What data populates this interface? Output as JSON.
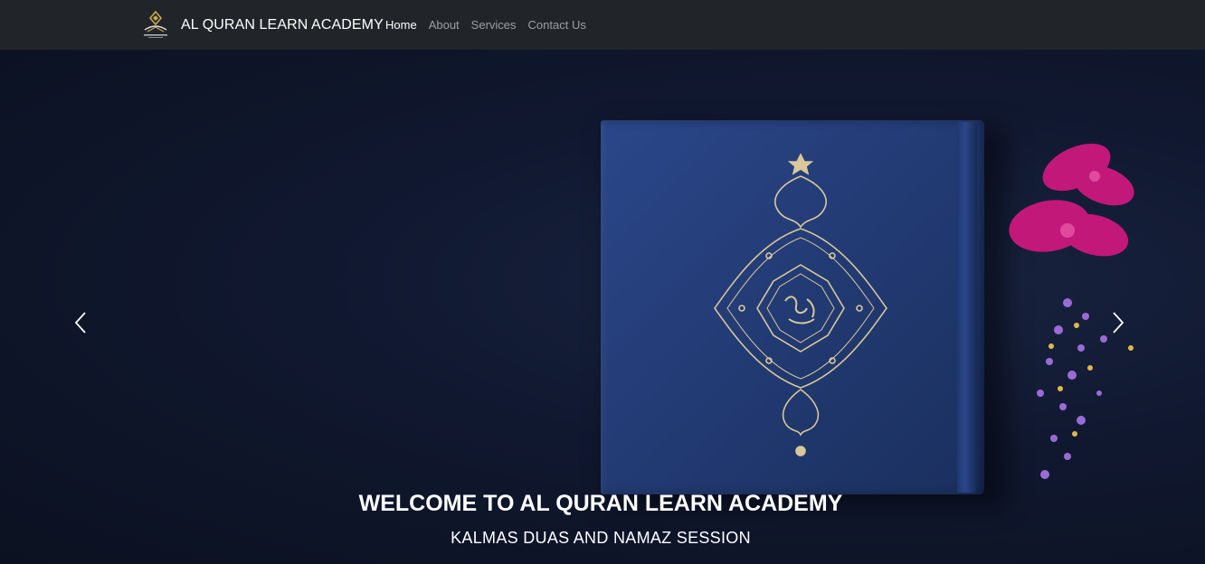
{
  "navbar": {
    "brand_name": "AL QURAN LEARN ACADEMY",
    "logo_icon": "academy-logo-icon",
    "links": [
      {
        "label": "Home",
        "active": true
      },
      {
        "label": "About",
        "active": false
      },
      {
        "label": "Services",
        "active": false
      },
      {
        "label": "Contact Us",
        "active": false
      }
    ]
  },
  "carousel": {
    "title": "WELCOME TO AL QURAN LEARN ACADEMY",
    "subtitle": "KALMAS DUAS AND NAMAZ SESSION",
    "prev_icon": "chevron-left-icon",
    "next_icon": "chevron-right-icon"
  },
  "colors": {
    "navbar_bg": "#212529",
    "hero_bg": "#101830",
    "book_blue": "#243d78",
    "ornament_gold": "#d8c89a",
    "flower_pink": "#c2187a"
  }
}
